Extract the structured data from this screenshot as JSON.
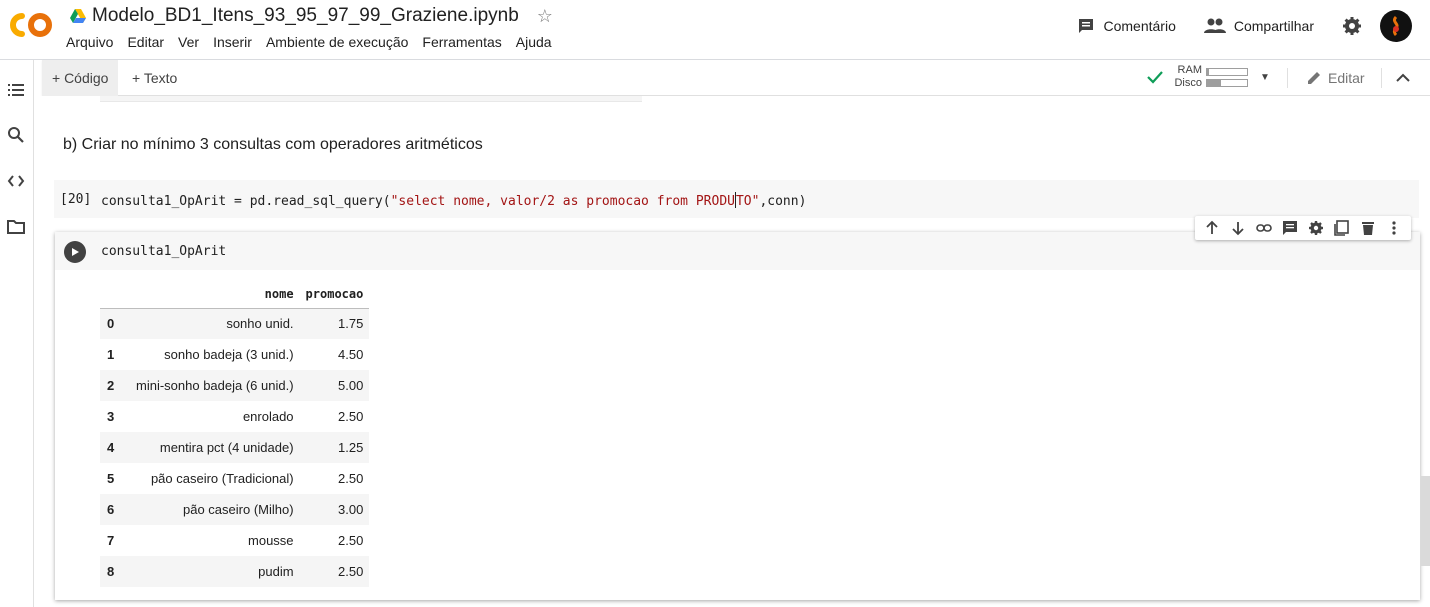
{
  "header": {
    "title": "Modelo_BD1_Itens_93_95_97_99_Graziene.ipynb",
    "menu": [
      "Arquivo",
      "Editar",
      "Ver",
      "Inserir",
      "Ambiente de execução",
      "Ferramentas",
      "Ajuda"
    ],
    "comment_label": "Comentário",
    "share_label": "Compartilhar"
  },
  "toolbar": {
    "add_code_label": "+ Código",
    "add_text_label": "+ Texto",
    "ram_label": "RAM",
    "disk_label": "Disco",
    "ram_usage": 0.05,
    "disk_usage": 0.35,
    "edit_label": "Editar"
  },
  "sidebar": {
    "icons": [
      "list-icon",
      "search-icon",
      "code-icon",
      "folder-icon"
    ]
  },
  "cells": {
    "text_cell": "b) Criar no mínimo 3 consultas com operadores aritméticos",
    "code_cell": {
      "exec_count": "[20]",
      "code_prefix": "consulta1_OpArit = pd.read_sql_query(",
      "code_string_a": "\"select nome, valor/2 as promocao from PRODU",
      "code_string_b": "TO\"",
      "code_suffix": ",conn)"
    },
    "active_cell": {
      "code": "consulta1_OpArit"
    }
  },
  "cell_toolbar": [
    "move-up-icon",
    "move-down-icon",
    "link-icon",
    "comment-icon",
    "settings-icon",
    "mirror-cell-icon",
    "delete-icon",
    "more-icon"
  ],
  "dataframe": {
    "columns": [
      "",
      "nome",
      "promocao"
    ],
    "rows": [
      [
        "0",
        "sonho unid.",
        "1.75"
      ],
      [
        "1",
        "sonho badeja (3 unid.)",
        "4.50"
      ],
      [
        "2",
        "mini-sonho badeja (6 unid.)",
        "5.00"
      ],
      [
        "3",
        "enrolado",
        "2.50"
      ],
      [
        "4",
        "mentira pct (4 unidade)",
        "1.25"
      ],
      [
        "5",
        "pão caseiro (Tradicional)",
        "2.50"
      ],
      [
        "6",
        "pão caseiro (Milho)",
        "3.00"
      ],
      [
        "7",
        "mousse",
        "2.50"
      ],
      [
        "8",
        "pudim",
        "2.50"
      ]
    ]
  },
  "colors": {
    "accent_orange": "#f9ab00",
    "check_green": "#0f9d58"
  }
}
